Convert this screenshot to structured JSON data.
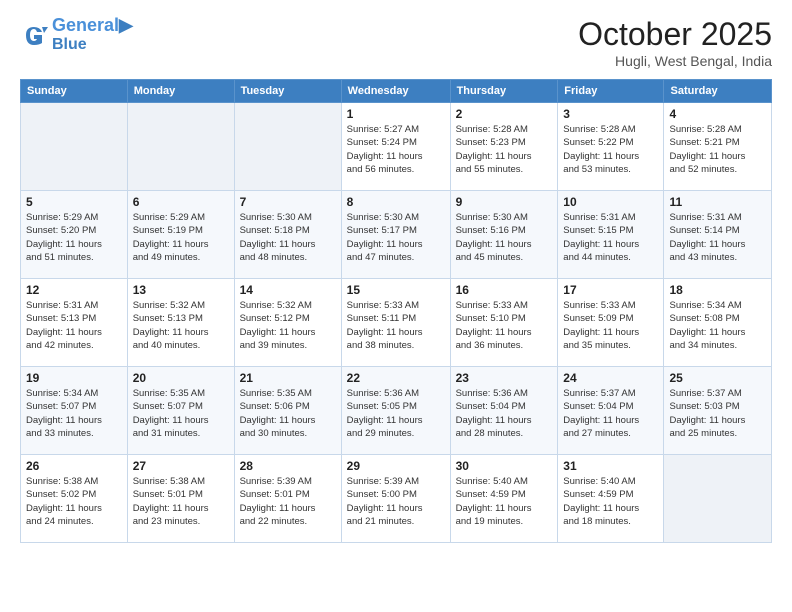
{
  "header": {
    "logo_line1": "General",
    "logo_line2": "Blue",
    "month": "October 2025",
    "location": "Hugli, West Bengal, India"
  },
  "weekdays": [
    "Sunday",
    "Monday",
    "Tuesday",
    "Wednesday",
    "Thursday",
    "Friday",
    "Saturday"
  ],
  "weeks": [
    [
      {
        "day": "",
        "info": ""
      },
      {
        "day": "",
        "info": ""
      },
      {
        "day": "",
        "info": ""
      },
      {
        "day": "1",
        "info": "Sunrise: 5:27 AM\nSunset: 5:24 PM\nDaylight: 11 hours\nand 56 minutes."
      },
      {
        "day": "2",
        "info": "Sunrise: 5:28 AM\nSunset: 5:23 PM\nDaylight: 11 hours\nand 55 minutes."
      },
      {
        "day": "3",
        "info": "Sunrise: 5:28 AM\nSunset: 5:22 PM\nDaylight: 11 hours\nand 53 minutes."
      },
      {
        "day": "4",
        "info": "Sunrise: 5:28 AM\nSunset: 5:21 PM\nDaylight: 11 hours\nand 52 minutes."
      }
    ],
    [
      {
        "day": "5",
        "info": "Sunrise: 5:29 AM\nSunset: 5:20 PM\nDaylight: 11 hours\nand 51 minutes."
      },
      {
        "day": "6",
        "info": "Sunrise: 5:29 AM\nSunset: 5:19 PM\nDaylight: 11 hours\nand 49 minutes."
      },
      {
        "day": "7",
        "info": "Sunrise: 5:30 AM\nSunset: 5:18 PM\nDaylight: 11 hours\nand 48 minutes."
      },
      {
        "day": "8",
        "info": "Sunrise: 5:30 AM\nSunset: 5:17 PM\nDaylight: 11 hours\nand 47 minutes."
      },
      {
        "day": "9",
        "info": "Sunrise: 5:30 AM\nSunset: 5:16 PM\nDaylight: 11 hours\nand 45 minutes."
      },
      {
        "day": "10",
        "info": "Sunrise: 5:31 AM\nSunset: 5:15 PM\nDaylight: 11 hours\nand 44 minutes."
      },
      {
        "day": "11",
        "info": "Sunrise: 5:31 AM\nSunset: 5:14 PM\nDaylight: 11 hours\nand 43 minutes."
      }
    ],
    [
      {
        "day": "12",
        "info": "Sunrise: 5:31 AM\nSunset: 5:13 PM\nDaylight: 11 hours\nand 42 minutes."
      },
      {
        "day": "13",
        "info": "Sunrise: 5:32 AM\nSunset: 5:13 PM\nDaylight: 11 hours\nand 40 minutes."
      },
      {
        "day": "14",
        "info": "Sunrise: 5:32 AM\nSunset: 5:12 PM\nDaylight: 11 hours\nand 39 minutes."
      },
      {
        "day": "15",
        "info": "Sunrise: 5:33 AM\nSunset: 5:11 PM\nDaylight: 11 hours\nand 38 minutes."
      },
      {
        "day": "16",
        "info": "Sunrise: 5:33 AM\nSunset: 5:10 PM\nDaylight: 11 hours\nand 36 minutes."
      },
      {
        "day": "17",
        "info": "Sunrise: 5:33 AM\nSunset: 5:09 PM\nDaylight: 11 hours\nand 35 minutes."
      },
      {
        "day": "18",
        "info": "Sunrise: 5:34 AM\nSunset: 5:08 PM\nDaylight: 11 hours\nand 34 minutes."
      }
    ],
    [
      {
        "day": "19",
        "info": "Sunrise: 5:34 AM\nSunset: 5:07 PM\nDaylight: 11 hours\nand 33 minutes."
      },
      {
        "day": "20",
        "info": "Sunrise: 5:35 AM\nSunset: 5:07 PM\nDaylight: 11 hours\nand 31 minutes."
      },
      {
        "day": "21",
        "info": "Sunrise: 5:35 AM\nSunset: 5:06 PM\nDaylight: 11 hours\nand 30 minutes."
      },
      {
        "day": "22",
        "info": "Sunrise: 5:36 AM\nSunset: 5:05 PM\nDaylight: 11 hours\nand 29 minutes."
      },
      {
        "day": "23",
        "info": "Sunrise: 5:36 AM\nSunset: 5:04 PM\nDaylight: 11 hours\nand 28 minutes."
      },
      {
        "day": "24",
        "info": "Sunrise: 5:37 AM\nSunset: 5:04 PM\nDaylight: 11 hours\nand 27 minutes."
      },
      {
        "day": "25",
        "info": "Sunrise: 5:37 AM\nSunset: 5:03 PM\nDaylight: 11 hours\nand 25 minutes."
      }
    ],
    [
      {
        "day": "26",
        "info": "Sunrise: 5:38 AM\nSunset: 5:02 PM\nDaylight: 11 hours\nand 24 minutes."
      },
      {
        "day": "27",
        "info": "Sunrise: 5:38 AM\nSunset: 5:01 PM\nDaylight: 11 hours\nand 23 minutes."
      },
      {
        "day": "28",
        "info": "Sunrise: 5:39 AM\nSunset: 5:01 PM\nDaylight: 11 hours\nand 22 minutes."
      },
      {
        "day": "29",
        "info": "Sunrise: 5:39 AM\nSunset: 5:00 PM\nDaylight: 11 hours\nand 21 minutes."
      },
      {
        "day": "30",
        "info": "Sunrise: 5:40 AM\nSunset: 4:59 PM\nDaylight: 11 hours\nand 19 minutes."
      },
      {
        "day": "31",
        "info": "Sunrise: 5:40 AM\nSunset: 4:59 PM\nDaylight: 11 hours\nand 18 minutes."
      },
      {
        "day": "",
        "info": ""
      }
    ]
  ]
}
